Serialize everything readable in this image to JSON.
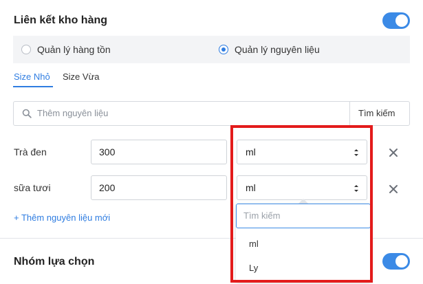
{
  "inventory": {
    "title": "Liên kết kho hàng",
    "enabled": true,
    "mode_options": [
      {
        "label": "Quản lý hàng tồn",
        "selected": false
      },
      {
        "label": "Quản lý nguyên liệu",
        "selected": true
      }
    ],
    "size_tabs": [
      {
        "label": "Size Nhỏ",
        "active": true
      },
      {
        "label": "Size Vừa",
        "active": false
      }
    ],
    "search": {
      "placeholder": "Thêm nguyên liệu",
      "button_label": "Tìm kiếm",
      "icon": "search-icon"
    },
    "ingredients": [
      {
        "name": "Trà đen",
        "quantity": "300",
        "unit": "ml"
      },
      {
        "name": "sữa tươi",
        "quantity": "200",
        "unit": "ml"
      }
    ],
    "add_ingredient_label": "+ Thêm nguyên liệu mới"
  },
  "unit_dropdown": {
    "search_placeholder": "Tìm kiếm",
    "options": [
      "ml",
      "Ly"
    ]
  },
  "option_group": {
    "title": "Nhóm lựa chọn",
    "enabled": true
  },
  "colors": {
    "accent": "#3b8ae6",
    "highlight": "#e31b1b"
  }
}
